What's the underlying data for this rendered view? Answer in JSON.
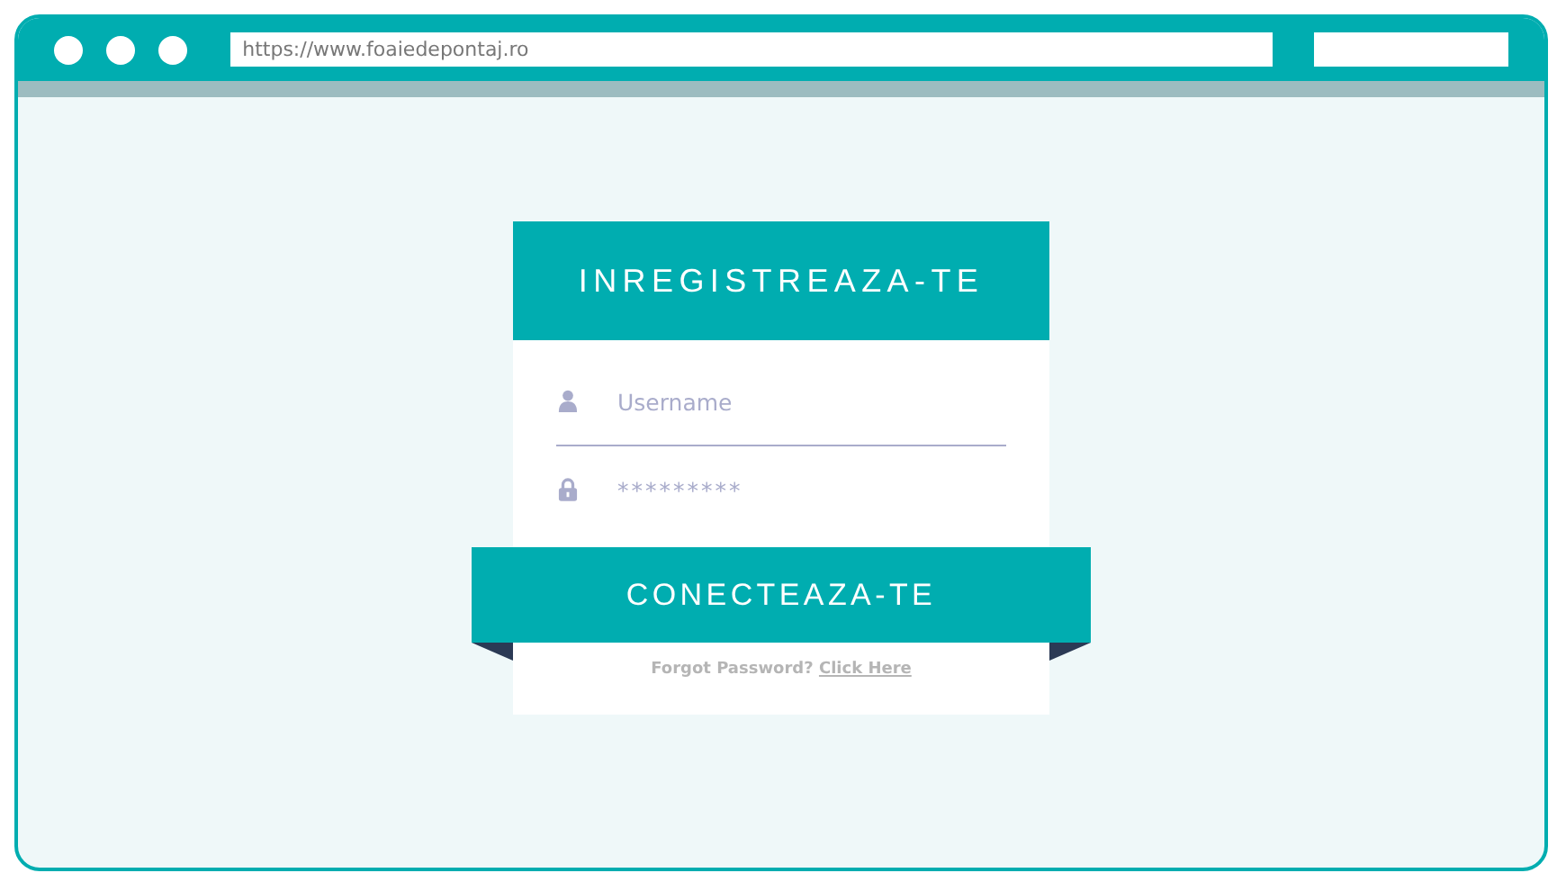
{
  "browser": {
    "url": "https://www.foaiedepontaj.ro"
  },
  "form": {
    "title": "INREGISTREAZA-TE",
    "fields": [
      {
        "kind": "user",
        "placeholder": "Username"
      },
      {
        "kind": "lock",
        "placeholder": "*********"
      }
    ],
    "submit": "CONECTEAZA-TE",
    "forgot": {
      "text": "Forgot Password?",
      "link": "Click Here"
    }
  }
}
